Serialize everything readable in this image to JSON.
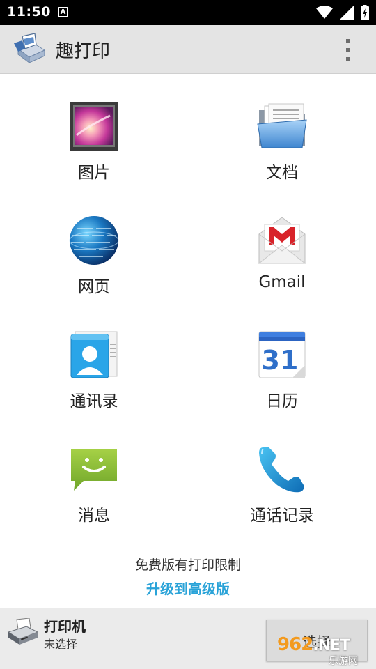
{
  "status_bar": {
    "time": "11:50",
    "notification_icon": "A",
    "icons": [
      "wifi-icon",
      "signal-icon",
      "battery-charging-icon"
    ]
  },
  "app_bar": {
    "title": "趣打印",
    "logo_icon": "printer-logo-icon",
    "menu_icon": "overflow-menu-icon"
  },
  "grid": {
    "items": [
      {
        "label": "图片",
        "icon": "gallery-icon"
      },
      {
        "label": "文档",
        "icon": "folder-documents-icon"
      },
      {
        "label": "网页",
        "icon": "globe-icon"
      },
      {
        "label": "Gmail",
        "icon": "gmail-icon"
      },
      {
        "label": "通讯录",
        "icon": "contacts-icon"
      },
      {
        "label": "日历",
        "icon": "calendar-icon",
        "calendar_day": "31"
      },
      {
        "label": "消息",
        "icon": "message-icon"
      },
      {
        "label": "通话记录",
        "icon": "phone-icon"
      }
    ]
  },
  "notice": {
    "text": "免费版有打印限制",
    "upgrade_link": "升级到高级版"
  },
  "printer": {
    "title": "打印机",
    "status": "未选择",
    "select_button": "选择"
  },
  "watermark": {
    "logo": "962",
    "logo_suffix": ".NET",
    "subtitle": "乐游网"
  },
  "colors": {
    "status_bar": "#000000",
    "app_bar": "#e4e4e4",
    "link": "#2aa3d8",
    "bottom_bar": "#ebebeb"
  }
}
